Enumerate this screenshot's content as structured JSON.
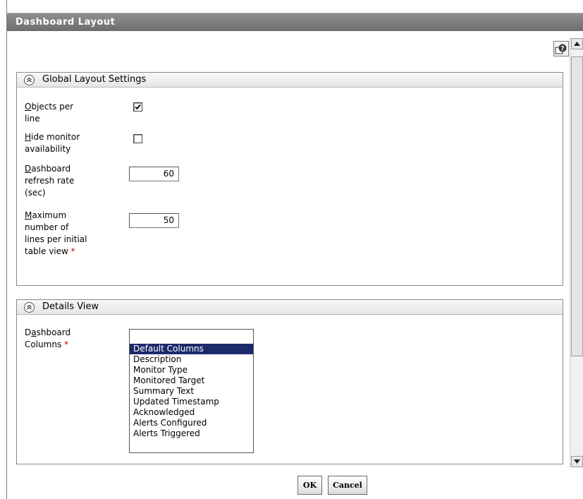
{
  "window": {
    "title": "Dashboard Layout"
  },
  "icons": {
    "help": "help-icon",
    "collapse": "collapse-chevrons-up-icon",
    "scroll_up": "arrow-up-icon",
    "scroll_down": "arrow-down-icon"
  },
  "global_settings": {
    "header": "Global Layout Settings",
    "objects_per_line": {
      "label_first": "O",
      "label_rest": "bjects per line",
      "checked": true
    },
    "hide_monitor_availability": {
      "label_first": "H",
      "label_rest": "ide monitor availability",
      "checked": false
    },
    "refresh_rate": {
      "label_first": "D",
      "label_rest": "ashboard refresh rate (sec)",
      "value": "60"
    },
    "max_lines": {
      "label_first": "M",
      "label_rest": "aximum number of lines per initial table view",
      "required_mark": "*",
      "value": "50"
    }
  },
  "details_view": {
    "header": "Details View",
    "dashboard_columns": {
      "label_pre": "D",
      "label_under": "a",
      "label_rest": "shboard Columns",
      "required_mark": "*",
      "options": [
        "Default Columns",
        "Description",
        "Monitor Type",
        "Monitored Target",
        "Summary Text",
        "Updated Timestamp",
        "Acknowledged",
        "Alerts Configured",
        "Alerts Triggered"
      ],
      "selected": "Default Columns"
    }
  },
  "buttons": {
    "ok": "OK",
    "cancel": "Cancel"
  },
  "colors": {
    "title_bar": "#7a7a7a",
    "selection": "#1c2a6b",
    "required": "#cc0000"
  }
}
